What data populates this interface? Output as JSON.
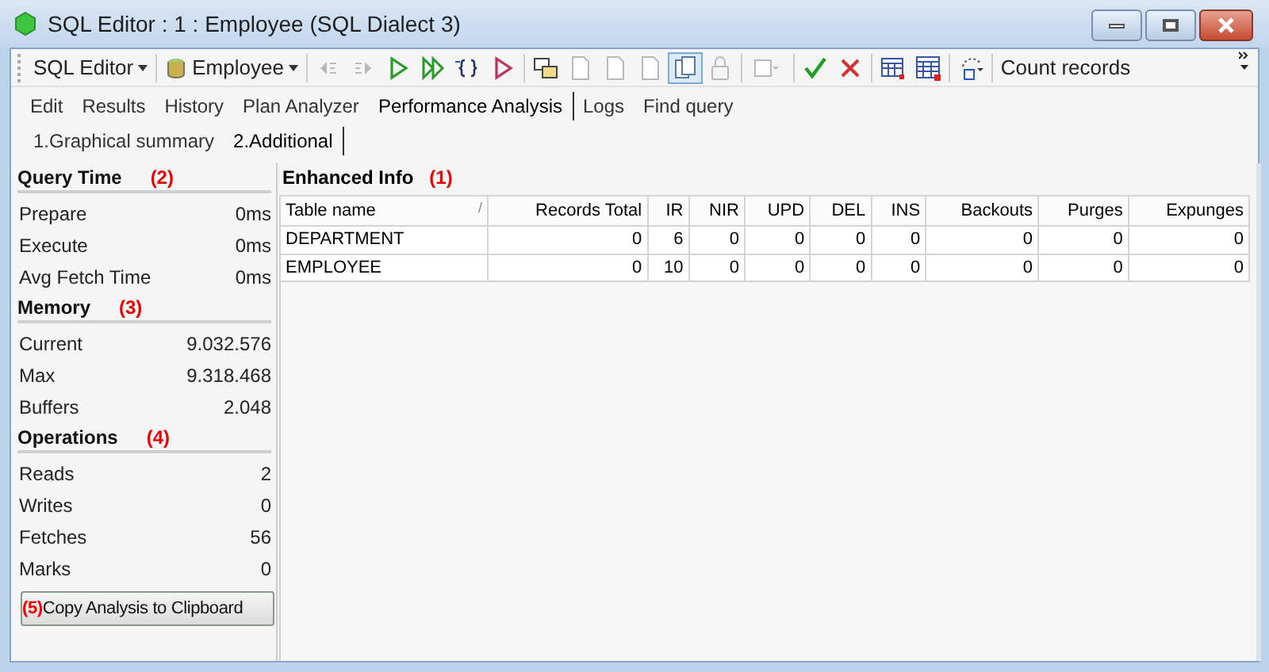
{
  "window": {
    "title": "SQL Editor : 1 : Employee (SQL Dialect 3)"
  },
  "toolbar": {
    "dropdowns": [
      {
        "label": "SQL Editor"
      },
      {
        "label": "Employee"
      }
    ],
    "tools": [
      {
        "kind": "prev",
        "disabled": true
      },
      {
        "kind": "next",
        "disabled": true
      },
      {
        "kind": "run",
        "disabled": false
      },
      {
        "kind": "run-all",
        "disabled": false
      },
      {
        "kind": "step",
        "disabled": false
      },
      {
        "kind": "stop",
        "disabled": false
      },
      {
        "kind": "sep"
      },
      {
        "kind": "plan",
        "disabled": false
      },
      {
        "kind": "doc",
        "disabled": true
      },
      {
        "kind": "doc",
        "disabled": true
      },
      {
        "kind": "doc",
        "disabled": true
      },
      {
        "kind": "pages",
        "disabled": false,
        "pressed": true
      },
      {
        "kind": "lock",
        "disabled": true
      },
      {
        "kind": "sep"
      },
      {
        "kind": "menu",
        "disabled": true
      },
      {
        "kind": "sep"
      },
      {
        "kind": "commit",
        "disabled": false
      },
      {
        "kind": "rollback",
        "disabled": false
      },
      {
        "kind": "sep"
      },
      {
        "kind": "grid",
        "disabled": false
      },
      {
        "kind": "grid2",
        "disabled": false
      },
      {
        "kind": "sep"
      },
      {
        "kind": "refresh",
        "disabled": false
      },
      {
        "kind": "sep"
      }
    ],
    "count_button": "Count records"
  },
  "tabs": [
    {
      "label": "Edit",
      "selected": false
    },
    {
      "label": "Results",
      "selected": false
    },
    {
      "label": "History",
      "selected": false
    },
    {
      "label": "Plan Analyzer",
      "selected": false
    },
    {
      "label": "Performance Analysis",
      "selected": true
    },
    {
      "label": "Logs",
      "selected": false
    },
    {
      "label": "Find query",
      "selected": false
    }
  ],
  "subtabs": [
    {
      "label": "1.Graphical summary",
      "selected": false
    },
    {
      "label": "2.Additional",
      "selected": true
    }
  ],
  "sections": [
    {
      "title": "Query Time",
      "marker": "(2)",
      "rows": [
        {
          "label": "Prepare",
          "value": "0ms"
        },
        {
          "label": "Execute",
          "value": "0ms"
        },
        {
          "label": "Avg Fetch Time",
          "value": "0ms"
        }
      ]
    },
    {
      "title": "Memory",
      "marker": "(3)",
      "rows": [
        {
          "label": "Current",
          "value": "9.032.576"
        },
        {
          "label": "Max",
          "value": "9.318.468"
        },
        {
          "label": "Buffers",
          "value": "2.048"
        }
      ]
    },
    {
      "title": "Operations",
      "marker": "(4)",
      "rows": [
        {
          "label": "Reads",
          "value": "2"
        },
        {
          "label": "Writes",
          "value": "0"
        },
        {
          "label": "Fetches",
          "value": "56"
        },
        {
          "label": "Marks",
          "value": "0"
        }
      ]
    }
  ],
  "copy_button": {
    "marker": "(5)",
    "label": "Copy Analysis to Clipboard"
  },
  "enhanced": {
    "title": "Enhanced Info",
    "marker": "(1)",
    "columns": [
      "Table name",
      "Records Total",
      "IR",
      "NIR",
      "UPD",
      "DEL",
      "INS",
      "Backouts",
      "Purges",
      "Expunges"
    ],
    "sort_mark": "/",
    "rows": [
      [
        "DEPARTMENT",
        "0",
        "6",
        "0",
        "0",
        "0",
        "0",
        "0",
        "0",
        "0"
      ],
      [
        "EMPLOYEE",
        "0",
        "10",
        "0",
        "0",
        "0",
        "0",
        "0",
        "0",
        "0"
      ]
    ]
  }
}
